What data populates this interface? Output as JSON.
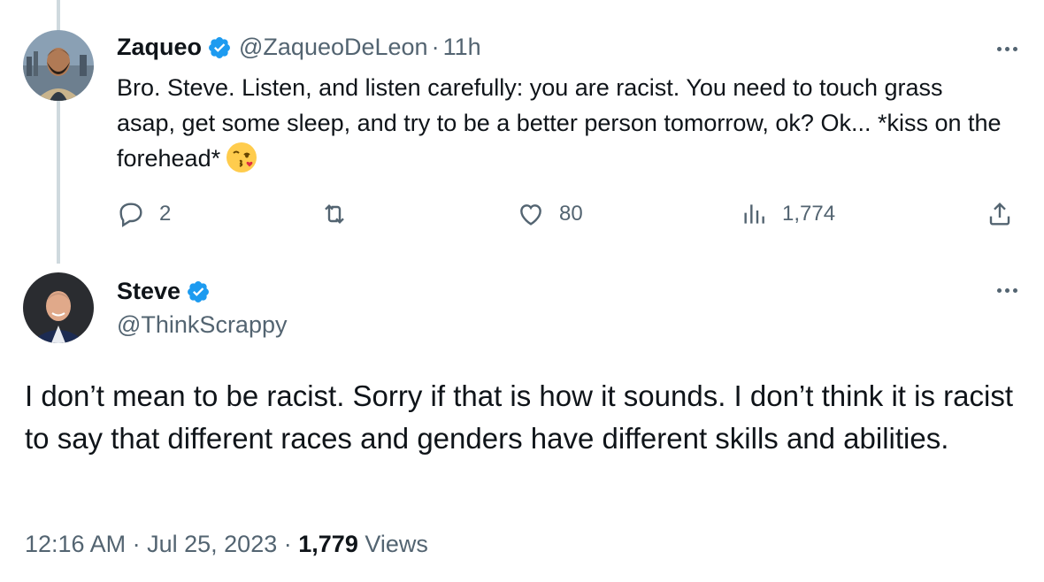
{
  "reply": {
    "display_name": "Zaqueo",
    "handle": "@ZaqueoDeLeon",
    "separator": "·",
    "time": "11h",
    "text": "Bro. Steve. Listen, and listen carefully: you are racist. You need to touch grass asap, get some sleep, and try to be a better person tomorrow, ok? Ok... *kiss on the forehead*",
    "emoji": "face-blowing-kiss",
    "actions": {
      "replies": "2",
      "retweets": "",
      "likes": "80",
      "views": "1,774"
    }
  },
  "main_tweet": {
    "display_name": "Steve",
    "handle": "@ThinkScrappy",
    "text": "I don’t mean to be racist. Sorry if that is how it sounds.  I don’t think it is racist to say that different races and genders have different skills and abilities.",
    "time": "12:16 AM",
    "sep1": "·",
    "date": "Jul 25, 2023",
    "sep2": "·",
    "views_count": "1,779",
    "views_label": "Views"
  },
  "colors": {
    "text": "#0f1419",
    "secondary": "#536471",
    "verified": "#1d9bf0",
    "thread_line": "#cfd9de"
  }
}
